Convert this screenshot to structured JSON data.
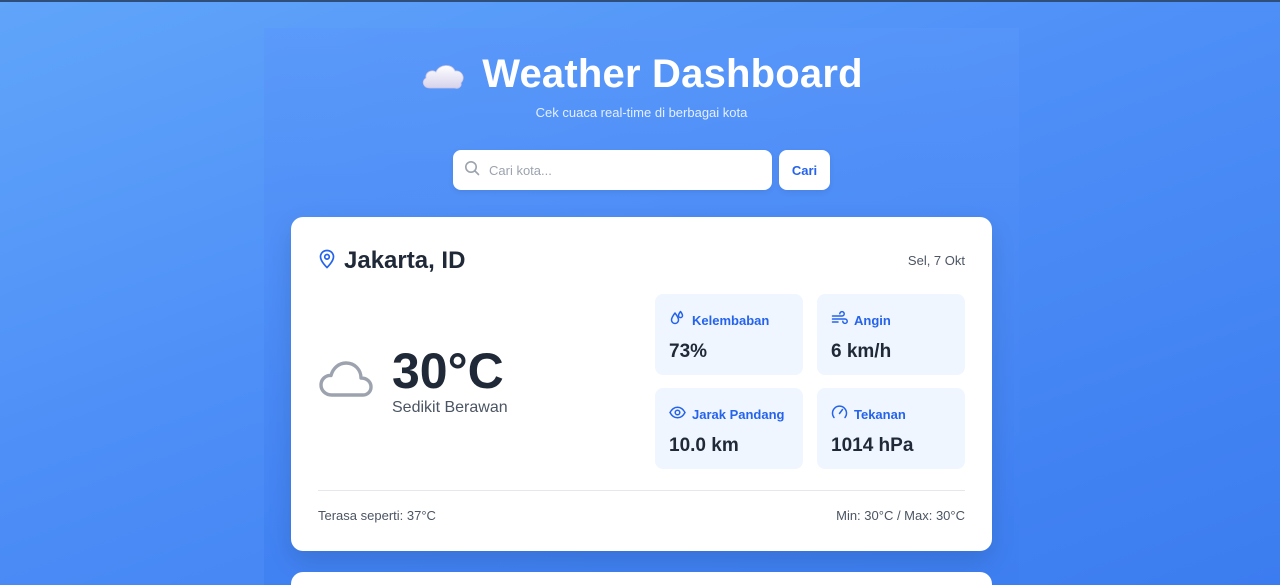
{
  "header": {
    "title": "Weather Dashboard",
    "subtitle": "Cek cuaca real-time di berbagai kota",
    "icon": "cloud-emoji-icon"
  },
  "search": {
    "placeholder": "Cari kota...",
    "value": "",
    "button_label": "Cari"
  },
  "weather": {
    "location": "Jakarta, ID",
    "date": "Sel, 7 Okt",
    "temperature": "30°C",
    "condition": "Sedikit Berawan",
    "condition_icon": "cloud-icon",
    "stats": [
      {
        "label": "Kelembaban",
        "value": "73%",
        "icon": "humidity-icon"
      },
      {
        "label": "Angin",
        "value": "6 km/h",
        "icon": "wind-icon"
      },
      {
        "label": "Jarak Pandang",
        "value": "10.0 km",
        "icon": "eye-icon"
      },
      {
        "label": "Tekanan",
        "value": "1014 hPa",
        "icon": "gauge-icon"
      }
    ],
    "feels_like": "Terasa seperti: 37°C",
    "min_max": "Min: 30°C / Max: 30°C"
  },
  "colors": {
    "accent": "#2563eb",
    "background_start": "#60a5fa",
    "background_end": "#3b7cf0",
    "stat_bg": "#eff6ff"
  }
}
